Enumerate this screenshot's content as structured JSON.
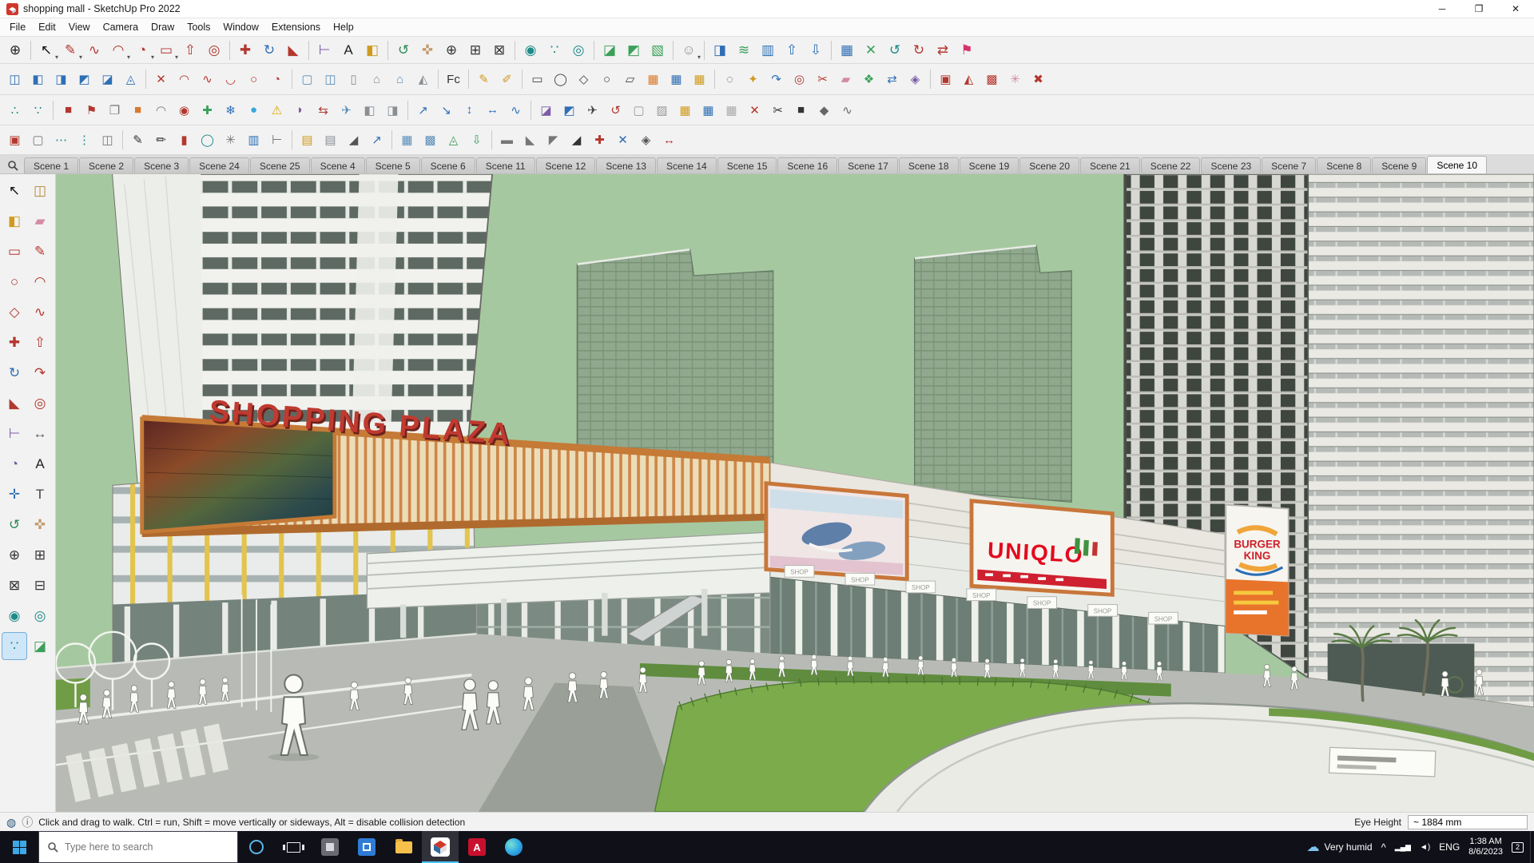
{
  "window": {
    "title": "shopping mall - SketchUp Pro 2022"
  },
  "menus": [
    {
      "n": "menu-file",
      "label": "File"
    },
    {
      "n": "menu-edit",
      "label": "Edit"
    },
    {
      "n": "menu-view",
      "label": "View"
    },
    {
      "n": "menu-camera",
      "label": "Camera"
    },
    {
      "n": "menu-draw",
      "label": "Draw"
    },
    {
      "n": "menu-tools",
      "label": "Tools"
    },
    {
      "n": "menu-window",
      "label": "Window"
    },
    {
      "n": "menu-extensions",
      "label": "Extensions"
    },
    {
      "n": "menu-help",
      "label": "Help"
    }
  ],
  "toolbars": {
    "row1": [
      {
        "n": "zoom-tool-icon",
        "g": "⊕",
        "c": "#222"
      },
      {
        "s": 1
      },
      {
        "n": "select-tool-icon",
        "g": "↖",
        "c": "#111",
        "d": 1
      },
      {
        "n": "line-tool-icon",
        "g": "✎",
        "c": "#b3372e",
        "d": 1
      },
      {
        "n": "freehand-tool-icon",
        "g": "∿",
        "c": "#b3372e"
      },
      {
        "n": "arc-tool-icon",
        "g": "◠",
        "c": "#b3372e",
        "d": 1
      },
      {
        "n": "pie-tool-icon",
        "g": "◔",
        "c": "#b3372e",
        "d": 1
      },
      {
        "n": "rectangle-tool-icon",
        "g": "▭",
        "c": "#b3372e",
        "d": 1
      },
      {
        "n": "push-pull-tool-icon",
        "g": "⇧",
        "c": "#b3372e"
      },
      {
        "n": "offset-tool-icon",
        "g": "◎",
        "c": "#b3372e"
      },
      {
        "s": 1
      },
      {
        "n": "move-tool-icon",
        "g": "✚",
        "c": "#b3372e"
      },
      {
        "n": "rotate-tool-icon",
        "g": "↻",
        "c": "#2e6fb5"
      },
      {
        "n": "scale-tool-icon",
        "g": "◣",
        "c": "#b3372e"
      },
      {
        "s": 1
      },
      {
        "n": "tape-measure-tool-icon",
        "g": "⊢",
        "c": "#7d5ba6"
      },
      {
        "n": "text-tool-icon",
        "g": "A",
        "c": "#222"
      },
      {
        "n": "paint-bucket-tool-icon",
        "g": "◧",
        "c": "#d19a1f"
      },
      {
        "s": 1
      },
      {
        "n": "orbit-tool-icon",
        "g": "↺",
        "c": "#2e8b57"
      },
      {
        "n": "pan-tool-icon",
        "g": "✜",
        "c": "#c49a6c"
      },
      {
        "n": "zoom-in-tool-icon",
        "g": "⊕",
        "c": "#333"
      },
      {
        "n": "zoom-window-tool-icon",
        "g": "⊞",
        "c": "#333"
      },
      {
        "n": "zoom-extents-tool-icon",
        "g": "⊠",
        "c": "#333"
      },
      {
        "s": 1
      },
      {
        "n": "position-camera-tool-icon",
        "g": "◉",
        "c": "#1f8a8a"
      },
      {
        "n": "walk-tool-icon",
        "g": "∵",
        "c": "#1f8a8a"
      },
      {
        "n": "look-around-tool-icon",
        "g": "◎",
        "c": "#1f8a8a"
      },
      {
        "s": 1
      },
      {
        "n": "section-plane-tool-icon",
        "g": "◪",
        "c": "#3aa05a"
      },
      {
        "n": "section-fill-toggle-icon",
        "g": "◩",
        "c": "#3aa05a"
      },
      {
        "n": "section-display-toggle-icon",
        "g": "▧",
        "c": "#3aa05a"
      },
      {
        "s": 1
      },
      {
        "n": "account-avatar-icon",
        "g": "☺",
        "c": "#8a9098",
        "d": 1
      },
      {
        "s": 1
      },
      {
        "n": "shadows-toggle-icon",
        "g": "◨",
        "c": "#2e6fb5"
      },
      {
        "n": "fog-toggle-icon",
        "g": "≋",
        "c": "#3aa05a"
      },
      {
        "n": "xray-toggle-icon",
        "g": "▥",
        "c": "#2e6fb5"
      },
      {
        "n": "move-up-icon",
        "g": "⇧",
        "c": "#2e6fb5"
      },
      {
        "n": "move-down-icon",
        "g": "⇩",
        "c": "#2e6fb5"
      },
      {
        "s": 1
      },
      {
        "n": "grid-tool-icon",
        "g": "▦",
        "c": "#2e6fb5"
      },
      {
        "n": "intersect-tool-icon",
        "g": "✕",
        "c": "#3aa05a"
      },
      {
        "n": "undo-icon",
        "g": "↺",
        "c": "#1f8a8a"
      },
      {
        "n": "redo-icon",
        "g": "↻",
        "c": "#b3372e"
      },
      {
        "n": "flip-tool-icon",
        "g": "⇄",
        "c": "#b3372e"
      },
      {
        "n": "add-location-icon",
        "g": "⚑",
        "c": "#d6336c"
      }
    ],
    "row2": [
      {
        "n": "outer-shell-icon",
        "g": "◫",
        "c": "#2e6fb5"
      },
      {
        "n": "solid-union-icon",
        "g": "◧",
        "c": "#2e6fb5"
      },
      {
        "n": "solid-subtract-icon",
        "g": "◨",
        "c": "#2e6fb5"
      },
      {
        "n": "solid-trim-icon",
        "g": "◩",
        "c": "#2e6fb5"
      },
      {
        "n": "solid-intersect-icon",
        "g": "◪",
        "c": "#2e6fb5"
      },
      {
        "n": "solid-split-icon",
        "g": "◬",
        "c": "#2e6fb5"
      },
      {
        "s": 1
      },
      {
        "n": "delete-edges-icon",
        "g": "✕",
        "c": "#b3372e"
      },
      {
        "n": "arc-segment-icon",
        "g": "◠",
        "c": "#b3372e"
      },
      {
        "n": "curve-edit-icon",
        "g": "∿",
        "c": "#b3372e"
      },
      {
        "n": "weld-edges-icon",
        "g": "◡",
        "c": "#b3372e"
      },
      {
        "n": "circle-segments-icon",
        "g": "○",
        "c": "#b3372e"
      },
      {
        "n": "divide-edge-icon",
        "g": "◔",
        "c": "#b3372e"
      },
      {
        "s": 1
      },
      {
        "n": "window-frame-icon",
        "g": "▢",
        "c": "#5b8db8"
      },
      {
        "n": "window-panel-icon",
        "g": "◫",
        "c": "#5b8db8"
      },
      {
        "n": "door-tool-icon",
        "g": "▯",
        "c": "#8a8f94"
      },
      {
        "n": "house-builder-icon",
        "g": "⌂",
        "c": "#8a8f94"
      },
      {
        "n": "house-builder-2-icon",
        "g": "⌂",
        "c": "#5b8db8"
      },
      {
        "n": "roof-tool-icon",
        "g": "◭",
        "c": "#8a8f94"
      },
      {
        "s": 1
      },
      {
        "n": "fredo-collection-icon",
        "g": "Fc",
        "c": "#333"
      },
      {
        "s": 1
      },
      {
        "n": "annotate-icon",
        "g": "✎",
        "c": "#d19a1f"
      },
      {
        "n": "tag-marker-icon",
        "g": "✐",
        "c": "#d19a1f"
      },
      {
        "s": 1
      },
      {
        "n": "draw-rectangle-icon",
        "g": "▭",
        "c": "#444"
      },
      {
        "n": "draw-ellipse-icon",
        "g": "◯",
        "c": "#444"
      },
      {
        "n": "draw-polygon-icon",
        "g": "◇",
        "c": "#444"
      },
      {
        "n": "draw-circle-icon",
        "g": "○",
        "c": "#444"
      },
      {
        "n": "draw-parallelogram-icon",
        "g": "▱",
        "c": "#444"
      },
      {
        "n": "grid-orange-icon",
        "g": "▦",
        "c": "#d87a2e"
      },
      {
        "n": "grid-blue-icon",
        "g": "▦",
        "c": "#2e6fb5"
      },
      {
        "n": "grid-yellow-icon",
        "g": "▦",
        "c": "#d19a1f"
      },
      {
        "s": 1
      },
      {
        "n": "lasso-select-icon",
        "g": "◌",
        "c": "#444"
      },
      {
        "n": "star-shape-icon",
        "g": "✦",
        "c": "#d19a1f"
      },
      {
        "n": "bend-tool-icon",
        "g": "↷",
        "c": "#2e6fb5"
      },
      {
        "n": "target-snap-icon",
        "g": "◎",
        "c": "#b3372e"
      },
      {
        "n": "knife-tool-icon",
        "g": "✂",
        "c": "#b3372e"
      },
      {
        "n": "soften-edges-icon",
        "g": "▰",
        "c": "#d58ba2"
      },
      {
        "n": "attach-tool-icon",
        "g": "❖",
        "c": "#3aa05a"
      },
      {
        "n": "swap-tool-icon",
        "g": "⇄",
        "c": "#2e6fb5"
      },
      {
        "n": "gem-tool-icon",
        "g": "◈",
        "c": "#7d5ba6"
      },
      {
        "s": 1
      },
      {
        "n": "stamp-copy-icon",
        "g": "▣",
        "c": "#b3372e"
      },
      {
        "n": "mirror-tool-icon",
        "g": "◭",
        "c": "#b3372e"
      },
      {
        "n": "array-copy-icon",
        "g": "▩",
        "c": "#b3372e"
      },
      {
        "n": "spray-paint-icon",
        "g": "✳",
        "c": "#d58ba2"
      },
      {
        "n": "big-delete-icon",
        "g": "✖",
        "c": "#b3372e"
      }
    ],
    "row3": [
      {
        "n": "vertex-tools-icon",
        "g": "∴",
        "c": "#1f8a8a"
      },
      {
        "n": "vertex-edit-icon",
        "g": "∵",
        "c": "#1f8a8a"
      },
      {
        "s": 1
      },
      {
        "n": "solid-red-box-icon",
        "g": "■",
        "c": "#b3372e"
      },
      {
        "n": "flag-marker-icon",
        "g": "⚑",
        "c": "#b3372e"
      },
      {
        "n": "material-pages-icon",
        "g": "❐",
        "c": "#777"
      },
      {
        "n": "crate-box-icon",
        "g": "■",
        "c": "#d87a2e"
      },
      {
        "n": "small-arc-icon",
        "g": "◠",
        "c": "#777"
      },
      {
        "n": "pin-point-icon",
        "g": "◉",
        "c": "#b3372e"
      },
      {
        "n": "add-item-icon",
        "g": "✚",
        "c": "#3aa05a"
      },
      {
        "n": "cleanup-icon",
        "g": "❄",
        "c": "#2e6fb5"
      },
      {
        "n": "water-drop-icon",
        "g": "●",
        "c": "#3ba7d9"
      },
      {
        "n": "warning-fix-icon",
        "g": "⚠",
        "c": "#e0a800"
      },
      {
        "n": "wedge-tool-icon",
        "g": "◗",
        "c": "#7d5ba6"
      },
      {
        "n": "swap-faces-icon",
        "g": "⇆",
        "c": "#b3372e"
      },
      {
        "n": "export-plane-icon",
        "g": "✈",
        "c": "#5b8db8"
      },
      {
        "n": "block-a-icon",
        "g": "◧",
        "c": "#8a8f94"
      },
      {
        "n": "block-b-icon",
        "g": "◨",
        "c": "#8a8f94"
      },
      {
        "s": 1
      },
      {
        "n": "arrow-ne-icon",
        "g": "↗",
        "c": "#2e6fb5"
      },
      {
        "n": "arrow-se-icon",
        "g": "↘",
        "c": "#2e6fb5"
      },
      {
        "n": "arrow-vertical-icon",
        "g": "↕",
        "c": "#2e6fb5"
      },
      {
        "n": "arrow-horizontal-icon",
        "g": "↔",
        "c": "#2e6fb5"
      },
      {
        "n": "wave-tool-icon",
        "g": "∿",
        "c": "#2e6fb5"
      },
      {
        "s": 1
      },
      {
        "n": "section-a-icon",
        "g": "◪",
        "c": "#7d5ba6"
      },
      {
        "n": "section-b-icon",
        "g": "◩",
        "c": "#2e6fb5"
      },
      {
        "n": "flight-path-icon",
        "g": "✈",
        "c": "#444"
      },
      {
        "n": "loop-select-icon",
        "g": "↺",
        "c": "#b3372e"
      },
      {
        "n": "empty-box-icon",
        "g": "▢",
        "c": "#999"
      },
      {
        "n": "hatch-box-icon",
        "g": "▨",
        "c": "#999"
      },
      {
        "n": "grid-gold-icon",
        "g": "▦",
        "c": "#d19a1f"
      },
      {
        "n": "grid-steel-icon",
        "g": "▦",
        "c": "#2e6fb5"
      },
      {
        "n": "grid-light-icon",
        "g": "▦",
        "c": "#aaa"
      },
      {
        "n": "remove-x-icon",
        "g": "✕",
        "c": "#b3372e"
      },
      {
        "n": "scissors-cut-icon",
        "g": "✂",
        "c": "#333"
      },
      {
        "n": "dark-cube-icon",
        "g": "■",
        "c": "#333"
      },
      {
        "n": "iso-diamond-icon",
        "g": "◆",
        "c": "#666"
      },
      {
        "n": "path-curve-icon",
        "g": "∿",
        "c": "#666"
      }
    ],
    "row4": [
      {
        "n": "component-stamp-icon",
        "g": "▣",
        "c": "#b3372e"
      },
      {
        "n": "component-frame-icon",
        "g": "▢",
        "c": "#777"
      },
      {
        "n": "points-horizontal-icon",
        "g": "⋯",
        "c": "#1f8a8a"
      },
      {
        "n": "points-vertical-icon",
        "g": "⋮",
        "c": "#1f8a8a"
      },
      {
        "n": "shape-combine-icon",
        "g": "◫",
        "c": "#777"
      },
      {
        "s": 1
      },
      {
        "n": "pencil-a-icon",
        "g": "✎",
        "c": "#333"
      },
      {
        "n": "pencil-b-icon",
        "g": "✏",
        "c": "#333"
      },
      {
        "n": "pipe-segment-icon",
        "g": "▮",
        "c": "#b3372e"
      },
      {
        "n": "tube-circle-icon",
        "g": "◯",
        "c": "#1f8a8a"
      },
      {
        "n": "gear-burst-icon",
        "g": "✳",
        "c": "#777"
      },
      {
        "n": "chart-panel-icon",
        "g": "▥",
        "c": "#2e6fb5"
      },
      {
        "n": "ruler-edge-icon",
        "g": "⊢",
        "c": "#777"
      },
      {
        "s": 1
      },
      {
        "n": "stairs-gold-icon",
        "g": "▤",
        "c": "#d19a1f"
      },
      {
        "n": "stairs-gray-icon",
        "g": "▤",
        "c": "#8a8f94"
      },
      {
        "n": "ramp-wedge-icon",
        "g": "◢",
        "c": "#555"
      },
      {
        "n": "rise-arrow-icon",
        "g": "↗",
        "c": "#2e6fb5"
      },
      {
        "s": 1
      },
      {
        "n": "terrain-mesh-icon",
        "g": "▦",
        "c": "#5b8db8"
      },
      {
        "n": "terrain-grid-icon",
        "g": "▩",
        "c": "#5b8db8"
      },
      {
        "n": "peak-tool-icon",
        "g": "◬",
        "c": "#3aa05a"
      },
      {
        "n": "drop-stamp-icon",
        "g": "⇩",
        "c": "#3aa05a"
      },
      {
        "s": 1
      },
      {
        "n": "flat-bar-icon",
        "g": "▬",
        "c": "#777"
      },
      {
        "n": "slope-left-icon",
        "g": "◣",
        "c": "#777"
      },
      {
        "n": "slope-corner-icon",
        "g": "◤",
        "c": "#777"
      },
      {
        "n": "dark-ramp-icon",
        "g": "◢",
        "c": "#333"
      },
      {
        "n": "cross-add-icon",
        "g": "✚",
        "c": "#b3372e"
      },
      {
        "n": "blue-x-icon",
        "g": "✕",
        "c": "#2e6fb5"
      },
      {
        "n": "gem-small-icon",
        "g": "◈",
        "c": "#555"
      },
      {
        "n": "span-arrow-icon",
        "g": "↔",
        "c": "#b3372e"
      }
    ]
  },
  "left_tools": [
    {
      "n": "select-tool-icon",
      "g": "↖",
      "c": "#111"
    },
    {
      "n": "make-component-icon",
      "g": "◫",
      "c": "#b58a3a"
    },
    {
      "n": "paint-bucket-icon",
      "g": "◧",
      "c": "#d19a1f"
    },
    {
      "n": "eraser-tool-icon",
      "g": "▰",
      "c": "#d58ba2"
    },
    {
      "n": "rectangle-tool-icon",
      "g": "▭",
      "c": "#b3372e"
    },
    {
      "n": "line-tool-icon",
      "g": "✎",
      "c": "#b3372e"
    },
    {
      "n": "circle-tool-icon",
      "g": "○",
      "c": "#b3372e"
    },
    {
      "n": "arc-tool-icon",
      "g": "◠",
      "c": "#b3372e"
    },
    {
      "n": "polygon-tool-icon",
      "g": "◇",
      "c": "#b3372e"
    },
    {
      "n": "freehand-tool-icon",
      "g": "∿",
      "c": "#b3372e"
    },
    {
      "n": "move-tool-icon",
      "g": "✚",
      "c": "#b3372e"
    },
    {
      "n": "push-pull-tool-icon",
      "g": "⇧",
      "c": "#b3372e"
    },
    {
      "n": "rotate-tool-icon",
      "g": "↻",
      "c": "#2e6fb5"
    },
    {
      "n": "follow-me-tool-icon",
      "g": "↷",
      "c": "#b3372e"
    },
    {
      "n": "scale-tool-icon",
      "g": "◣",
      "c": "#b3372e"
    },
    {
      "n": "offset-tool-icon",
      "g": "◎",
      "c": "#b3372e"
    },
    {
      "n": "tape-measure-icon",
      "g": "⊢",
      "c": "#7d5ba6"
    },
    {
      "n": "dimension-tool-icon",
      "g": "↔",
      "c": "#555"
    },
    {
      "n": "protractor-tool-icon",
      "g": "◔",
      "c": "#7d5ba6"
    },
    {
      "n": "text-tool-icon",
      "g": "A",
      "c": "#222"
    },
    {
      "n": "axes-tool-icon",
      "g": "✛",
      "c": "#2e6fb5"
    },
    {
      "n": "three-d-text-icon",
      "g": "T",
      "c": "#444"
    },
    {
      "n": "orbit-tool-icon",
      "g": "↺",
      "c": "#2e8b57"
    },
    {
      "n": "pan-tool-icon",
      "g": "✜",
      "c": "#c49a6c"
    },
    {
      "n": "zoom-tool-icon",
      "g": "⊕",
      "c": "#333"
    },
    {
      "n": "zoom-window-icon",
      "g": "⊞",
      "c": "#333"
    },
    {
      "n": "zoom-extents-icon",
      "g": "⊠",
      "c": "#333"
    },
    {
      "n": "zoom-previous-icon",
      "g": "⊟",
      "c": "#333"
    },
    {
      "n": "position-camera-icon",
      "g": "◉",
      "c": "#1f8a8a"
    },
    {
      "n": "look-around-icon",
      "g": "◎",
      "c": "#1f8a8a"
    },
    {
      "n": "walk-tool-icon",
      "g": "∵",
      "c": "#1f8a8a",
      "a": 1
    },
    {
      "n": "section-plane-icon",
      "g": "◪",
      "c": "#3aa05a"
    }
  ],
  "scene_tabs": [
    {
      "n": "scene-tab-1",
      "label": "Scene 1"
    },
    {
      "n": "scene-tab-2",
      "label": "Scene 2"
    },
    {
      "n": "scene-tab-3",
      "label": "Scene 3"
    },
    {
      "n": "scene-tab-24",
      "label": "Scene 24"
    },
    {
      "n": "scene-tab-25",
      "label": "Scene 25"
    },
    {
      "n": "scene-tab-4",
      "label": "Scene 4"
    },
    {
      "n": "scene-tab-5",
      "label": "Scene 5"
    },
    {
      "n": "scene-tab-6",
      "label": "Scene 6"
    },
    {
      "n": "scene-tab-11",
      "label": "Scene 11"
    },
    {
      "n": "scene-tab-12",
      "label": "Scene 12"
    },
    {
      "n": "scene-tab-13",
      "label": "Scene 13"
    },
    {
      "n": "scene-tab-14",
      "label": "Scene 14"
    },
    {
      "n": "scene-tab-15",
      "label": "Scene 15"
    },
    {
      "n": "scene-tab-16",
      "label": "Scene 16"
    },
    {
      "n": "scene-tab-17",
      "label": "Scene 17"
    },
    {
      "n": "scene-tab-18",
      "label": "Scene 18"
    },
    {
      "n": "scene-tab-19",
      "label": "Scene 19"
    },
    {
      "n": "scene-tab-20",
      "label": "Scene 20"
    },
    {
      "n": "scene-tab-21",
      "label": "Scene 21"
    },
    {
      "n": "scene-tab-22",
      "label": "Scene 22"
    },
    {
      "n": "scene-tab-23",
      "label": "Scene 23"
    },
    {
      "n": "scene-tab-7",
      "label": "Scene 7"
    },
    {
      "n": "scene-tab-8",
      "label": "Scene 8"
    },
    {
      "n": "scene-tab-9",
      "label": "Scene 9"
    },
    {
      "n": "scene-tab-10",
      "label": "Scene 10",
      "a": 1
    }
  ],
  "viewport": {
    "signs": {
      "shopping_plaza": "SHOPPING PLAZA",
      "uniqlo": "UNIQLO",
      "burger": "BURGER",
      "king": "KING",
      "shop": "SHOP"
    }
  },
  "statusbar": {
    "hint": "Click and drag to walk.  Ctrl = run, Shift = move vertically or sideways, Alt = disable collision detection",
    "eye_height_label": "Eye Height",
    "eye_height_value": "~ 1884 mm"
  },
  "taskbar": {
    "search_placeholder": "Type here to search",
    "weather": "Very humid",
    "lang": "ENG",
    "time": "1:38 AM",
    "date": "8/6/2023",
    "badge": "2"
  }
}
